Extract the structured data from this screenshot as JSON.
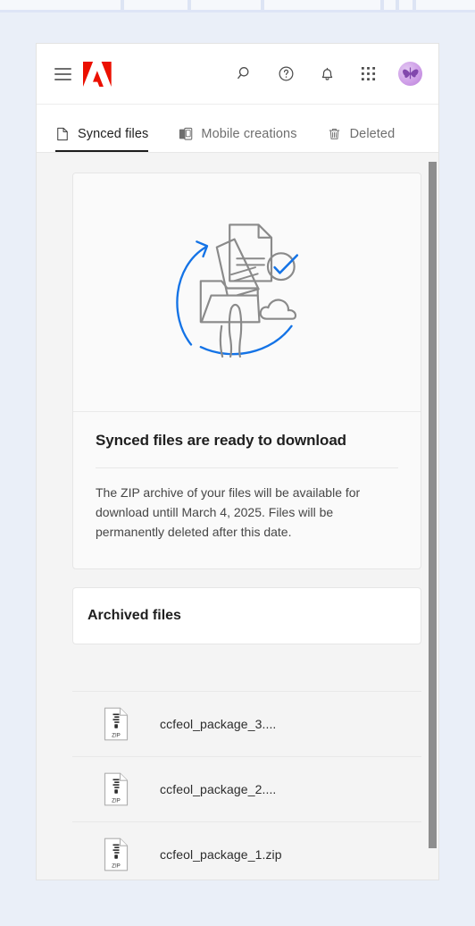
{
  "window": {
    "background_color": "#eaeff8",
    "app_background": "#f4f4f4"
  },
  "header": {
    "menu_label": "Menu",
    "brand": "Adobe",
    "brand_color": "#eb1000",
    "icons": [
      {
        "name": "search-icon",
        "label": "Search"
      },
      {
        "name": "help-icon",
        "label": "Help"
      },
      {
        "name": "notifications-icon",
        "label": "Notifications"
      },
      {
        "name": "app-switcher-icon",
        "label": "Apps"
      }
    ],
    "avatar_label": "Account"
  },
  "tabs": [
    {
      "label": "Synced files",
      "icon": "file-icon",
      "active": true
    },
    {
      "label": "Mobile creations",
      "icon": "mobile-device-icon",
      "active": false
    },
    {
      "label": "Deleted",
      "icon": "trash-icon",
      "active": false
    }
  ],
  "hero": {
    "illustration_name": "sync-download-illustration",
    "title": "Synced files are ready to download",
    "body": "The ZIP archive of your files will be available for download untill March 4, 2025. Files will be permanently deleted after this date.",
    "accent_color": "#1473e6"
  },
  "archived": {
    "title": "Archived files"
  },
  "files": [
    {
      "name": "ccfeol_package_3....",
      "type": "ZIP"
    },
    {
      "name": "ccfeol_package_2....",
      "type": "ZIP"
    },
    {
      "name": "ccfeol_package_1.zip",
      "type": "ZIP"
    }
  ],
  "scrollbar": {
    "thumb_color": "#8e8e8e"
  }
}
